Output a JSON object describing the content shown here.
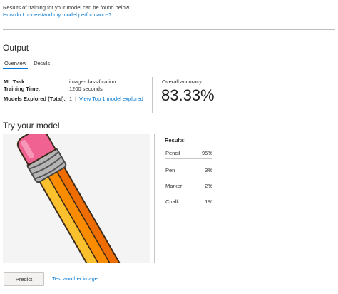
{
  "intro": {
    "text": "Results of training for your model can be found below.",
    "link": "How do I understand my model performance?"
  },
  "output": {
    "title": "Output",
    "tabs": [
      {
        "label": "Overview",
        "active": true
      },
      {
        "label": "Details",
        "active": false
      }
    ],
    "ml_task_label": "ML Task:",
    "ml_task_value": "image-classification",
    "training_time_label": "Training Time:",
    "training_time_value": "1200 seconds",
    "models_explored_label": "Models Explored (Total):",
    "models_explored_value": "1",
    "models_explored_separator": "|",
    "view_top_link": "View Top 1 model explored",
    "accuracy_label": "Overall accuracy:",
    "accuracy_value": "83.33%"
  },
  "try_model": {
    "title": "Try your model",
    "image_subject": "pencil-image",
    "results_title": "Results:",
    "results": [
      {
        "label": "Pencil",
        "value": "95%"
      },
      {
        "label": "Pen",
        "value": "3%"
      },
      {
        "label": "Marker",
        "value": "2%"
      },
      {
        "label": "Chalk",
        "value": "1%"
      }
    ],
    "predict_label": "Predict",
    "test_another_label": "Test another image"
  },
  "colors": {
    "accent": "#0078d4",
    "eraser": "#f06292",
    "ferrule": "#b0b0b0",
    "pencil_yellow": "#fbc02d",
    "pencil_orange": "#fb8c00",
    "pencil_dark_orange": "#ef6c00"
  }
}
